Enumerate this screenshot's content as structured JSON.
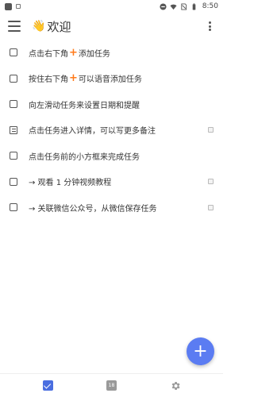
{
  "status_bar": {
    "time": "8:50"
  },
  "app_bar": {
    "title_emoji": "👋",
    "title": "欢迎"
  },
  "tasks": [
    {
      "before": "点击右下角",
      "plus": "+",
      "after": "添加任务",
      "icon": "checkbox",
      "has_tail_icon": false
    },
    {
      "before": "按住右下角",
      "plus": "+",
      "after": "可以语音添加任务",
      "icon": "checkbox",
      "has_tail_icon": false
    },
    {
      "before": "向左滑动任务来设置日期和提醒",
      "plus": "",
      "after": "",
      "icon": "checkbox",
      "has_tail_icon": false
    },
    {
      "before": "点击任务进入详情，可以写更多备注",
      "plus": "",
      "after": "",
      "icon": "note",
      "has_tail_icon": true
    },
    {
      "before": "点击任务前的小方框来完成任务",
      "plus": "",
      "after": "",
      "icon": "checkbox",
      "has_tail_icon": false
    },
    {
      "before": "→ 观看 1 分钟视频教程",
      "plus": "",
      "after": "",
      "icon": "checkbox",
      "has_tail_icon": true
    },
    {
      "before": "→ 关联微信公众号，从微信保存任务",
      "plus": "",
      "after": "",
      "icon": "checkbox",
      "has_tail_icon": true
    }
  ],
  "fab": {
    "label": "+"
  },
  "bottom_nav": {
    "calendar_day": "18"
  },
  "colors": {
    "accent": "#5b7cf2",
    "plus_orange": "#ff7a1a",
    "nav_active": "#4a6ee0"
  }
}
